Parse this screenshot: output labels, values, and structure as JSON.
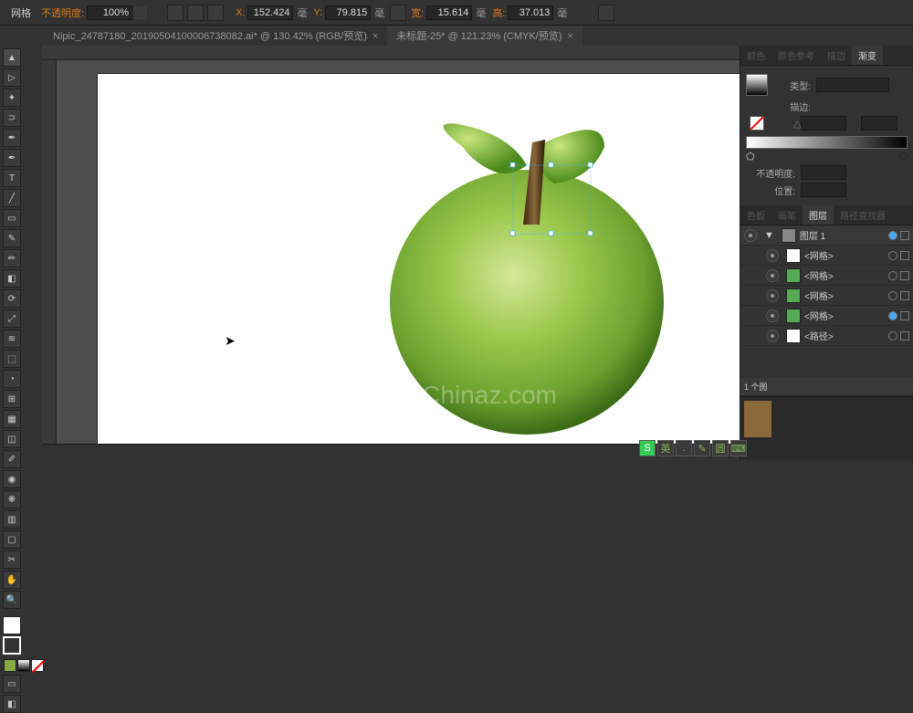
{
  "topbar": {
    "tool": "网格",
    "opacity_lbl": "不透明度:",
    "opacity": "100%",
    "x_lbl": "X:",
    "x": "152.424",
    "y_lbl": "Y:",
    "y": "79.815",
    "unit": "毫",
    "w_lbl": "宽:",
    "w": "15.614",
    "h_lbl": "高:",
    "h": "37.013"
  },
  "tabs": [
    {
      "label": "Nipic_24787180_20190504100006738082.ai* @ 130.42% (RGB/预览)",
      "active": false
    },
    {
      "label": "未标题-25* @ 121.23% (CMYK/预览)",
      "active": true
    }
  ],
  "gradient": {
    "tabs": [
      "颜色",
      "颜色参考",
      "描边",
      "渐变"
    ],
    "active": 3,
    "type_lbl": "类型:",
    "stroke_lbl": "描边:",
    "opacity_lbl": "不透明度:",
    "pos_lbl": "位置:"
  },
  "layers": {
    "tabs": [
      "色板",
      "画笔",
      "图层",
      "路径查找器"
    ],
    "active": 2,
    "top": "图层 1",
    "items": [
      {
        "name": "<网格>"
      },
      {
        "name": "<网格>"
      },
      {
        "name": "<网格>"
      },
      {
        "name": "<网格>"
      },
      {
        "name": "<路径>"
      }
    ],
    "count": "1 个图"
  },
  "ime": [
    "S",
    "英",
    ".",
    "✎",
    "圆",
    "⌨"
  ],
  "watermark": "Chinaz.com"
}
